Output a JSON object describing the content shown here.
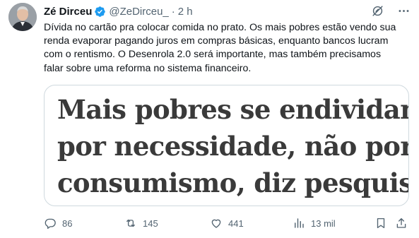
{
  "author": {
    "name": "Zé Dirceu",
    "handle": "@ZeDirceu_",
    "separator": "·",
    "time": "2 h"
  },
  "tweet": {
    "text": "Dívida no cartão pra colocar comida no prato. Os mais pobres estão vendo sua renda evaporar pagando juros em compras básicas, enquanto bancos lucram com o rentismo. O Desenrola 2.0 será importante, mas também precisamos falar sobre uma reforma no sistema financeiro."
  },
  "card": {
    "headline_lines": [
      "Mais pobres se endividam",
      "por necessidade, não por",
      "consumismo, diz pesquisa"
    ]
  },
  "actions": {
    "replies": "86",
    "retweets": "145",
    "likes": "441",
    "views": "13 mil"
  },
  "icons": {
    "verified": "verified-badge-icon",
    "grok": "grok-icon",
    "more": "more-icon",
    "reply": "reply-icon",
    "retweet": "retweet-icon",
    "like": "heart-icon",
    "views": "views-icon",
    "bookmark": "bookmark-icon",
    "share": "share-icon"
  },
  "colors": {
    "accent": "#1d9bf0",
    "muted": "#536471",
    "text": "#0f1419",
    "border": "#cfd9de"
  }
}
